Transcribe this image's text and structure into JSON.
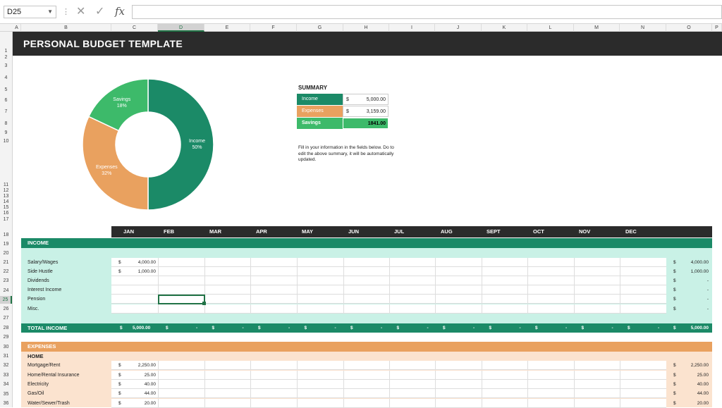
{
  "formula_bar": {
    "name_box": "D25",
    "fx_label": "fx",
    "formula": ""
  },
  "columns": [
    "A",
    "B",
    "C",
    "D",
    "E",
    "F",
    "G",
    "H",
    "I",
    "J",
    "K",
    "L",
    "M",
    "N",
    "O",
    "P"
  ],
  "selected_column": "D",
  "rows": [
    "1",
    "2",
    "3",
    "4",
    "5",
    "6",
    "7",
    "8",
    "9",
    "10",
    "11",
    "12",
    "13",
    "14",
    "15",
    "16",
    "17",
    "18",
    "19",
    "20",
    "21",
    "22",
    "23",
    "24",
    "25",
    "26",
    "27",
    "28",
    "29",
    "30",
    "31",
    "32",
    "33",
    "34",
    "35",
    "36"
  ],
  "selected_row": "25",
  "title": "PERSONAL BUDGET TEMPLATE",
  "chart_data": {
    "type": "pie",
    "slices": [
      {
        "label": "Income",
        "pct_label": "50%",
        "value": 50,
        "color": "#1b8a67"
      },
      {
        "label": "Expenses",
        "pct_label": "32%",
        "value": 32,
        "color": "#e9a15f"
      },
      {
        "label": "Savings",
        "pct_label": "18%",
        "value": 18,
        "color": "#3dba6a"
      }
    ]
  },
  "summary": {
    "title": "SUMMARY",
    "rows": [
      {
        "label": "Income",
        "currency": "$",
        "value": "5,000.00",
        "color": "#1b8a67"
      },
      {
        "label": "Expenses",
        "currency": "$",
        "value": "3,159.00",
        "color": "#e9a15f"
      },
      {
        "label": "Savings",
        "currency": "",
        "value": "1841.00",
        "color": "#3dba6a"
      }
    ]
  },
  "note": "Fill in your information in the fields below. Do to edit the above summary, it will be automatically updated.",
  "months": [
    "JAN",
    "FEB",
    "MAR",
    "APR",
    "MAY",
    "JUN",
    "JUL",
    "AUG",
    "SEPT",
    "OCT",
    "NOV",
    "DEC"
  ],
  "income": {
    "title": "INCOME",
    "rows": [
      {
        "label": "Salary/Wages",
        "jan_cur": "$",
        "jan": "4,000.00",
        "tot_cur": "$",
        "total": "4,000.00"
      },
      {
        "label": "Side Hustle",
        "jan_cur": "$",
        "jan": "1,000.00",
        "tot_cur": "$",
        "total": "1,000.00"
      },
      {
        "label": "Dividends",
        "jan_cur": "",
        "jan": "",
        "tot_cur": "$",
        "total": "-"
      },
      {
        "label": "Interest Income",
        "jan_cur": "",
        "jan": "",
        "tot_cur": "$",
        "total": "-"
      },
      {
        "label": "Pension",
        "jan_cur": "",
        "jan": "",
        "tot_cur": "$",
        "total": "-"
      },
      {
        "label": "Misc.",
        "jan_cur": "",
        "jan": "",
        "tot_cur": "$",
        "total": "-"
      }
    ]
  },
  "total_income": {
    "label": "TOTAL INCOME",
    "currency": "$",
    "jan": "5,000.00",
    "dash": "-",
    "total": "5,000.00"
  },
  "expenses": {
    "title": "EXPENSES",
    "group": "HOME",
    "rows": [
      {
        "label": "Mortgage/Rent",
        "cur": "$",
        "jan": "2,250.00",
        "tot_cur": "$",
        "total": "2,250.00"
      },
      {
        "label": "Home/Rental Insurance",
        "cur": "$",
        "jan": "25.00",
        "tot_cur": "$",
        "total": "25.00"
      },
      {
        "label": "Electricity",
        "cur": "$",
        "jan": "40.00",
        "tot_cur": "$",
        "total": "40.00"
      },
      {
        "label": "Gas/Oil",
        "cur": "$",
        "jan": "44.00",
        "tot_cur": "$",
        "total": "44.00"
      },
      {
        "label": "Water/Sewer/Trash",
        "cur": "$",
        "jan": "20.00",
        "tot_cur": "$",
        "total": "20.00"
      }
    ]
  }
}
